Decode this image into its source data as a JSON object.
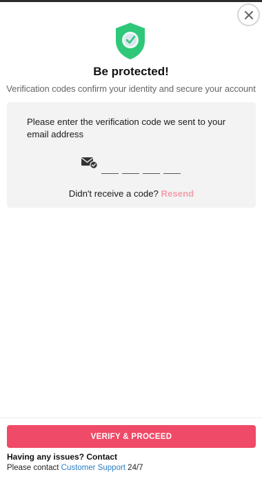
{
  "header": {
    "close_icon": "close-icon",
    "title": "Be protected!",
    "subtitle": "Verification codes confirm your identity and secure your account",
    "shield_icon": "shield-check-icon",
    "shield_color": "#2fc77a"
  },
  "verification": {
    "instruction": "Please enter the verification code we sent to your email address",
    "mail_icon": "email-verified-icon",
    "code_slots": [
      "",
      "",
      "",
      ""
    ],
    "resend_prompt": "Didn't receive a code?",
    "resend_label": "Resend"
  },
  "footer": {
    "verify_label": "VERIFY & PROCEED",
    "issues_heading": "Having any issues? Contact",
    "contact_prefix": "Please contact",
    "support_link": "Customer Support",
    "contact_suffix": "24/7"
  },
  "colors": {
    "accent": "#ef4a67",
    "resend": "#f2a0ac",
    "link": "#2a7dc1"
  }
}
